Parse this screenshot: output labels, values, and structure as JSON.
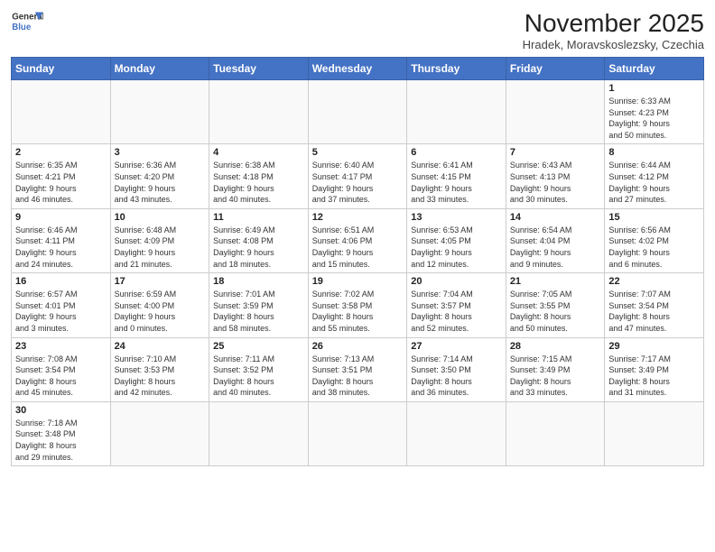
{
  "header": {
    "logo_general": "General",
    "logo_blue": "Blue",
    "title": "November 2025",
    "subtitle": "Hradek, Moravskoslezsky, Czechia"
  },
  "weekdays": [
    "Sunday",
    "Monday",
    "Tuesday",
    "Wednesday",
    "Thursday",
    "Friday",
    "Saturday"
  ],
  "weeks": [
    [
      {
        "day": "",
        "info": ""
      },
      {
        "day": "",
        "info": ""
      },
      {
        "day": "",
        "info": ""
      },
      {
        "day": "",
        "info": ""
      },
      {
        "day": "",
        "info": ""
      },
      {
        "day": "",
        "info": ""
      },
      {
        "day": "1",
        "info": "Sunrise: 6:33 AM\nSunset: 4:23 PM\nDaylight: 9 hours\nand 50 minutes."
      }
    ],
    [
      {
        "day": "2",
        "info": "Sunrise: 6:35 AM\nSunset: 4:21 PM\nDaylight: 9 hours\nand 46 minutes."
      },
      {
        "day": "3",
        "info": "Sunrise: 6:36 AM\nSunset: 4:20 PM\nDaylight: 9 hours\nand 43 minutes."
      },
      {
        "day": "4",
        "info": "Sunrise: 6:38 AM\nSunset: 4:18 PM\nDaylight: 9 hours\nand 40 minutes."
      },
      {
        "day": "5",
        "info": "Sunrise: 6:40 AM\nSunset: 4:17 PM\nDaylight: 9 hours\nand 37 minutes."
      },
      {
        "day": "6",
        "info": "Sunrise: 6:41 AM\nSunset: 4:15 PM\nDaylight: 9 hours\nand 33 minutes."
      },
      {
        "day": "7",
        "info": "Sunrise: 6:43 AM\nSunset: 4:13 PM\nDaylight: 9 hours\nand 30 minutes."
      },
      {
        "day": "8",
        "info": "Sunrise: 6:44 AM\nSunset: 4:12 PM\nDaylight: 9 hours\nand 27 minutes."
      }
    ],
    [
      {
        "day": "9",
        "info": "Sunrise: 6:46 AM\nSunset: 4:11 PM\nDaylight: 9 hours\nand 24 minutes."
      },
      {
        "day": "10",
        "info": "Sunrise: 6:48 AM\nSunset: 4:09 PM\nDaylight: 9 hours\nand 21 minutes."
      },
      {
        "day": "11",
        "info": "Sunrise: 6:49 AM\nSunset: 4:08 PM\nDaylight: 9 hours\nand 18 minutes."
      },
      {
        "day": "12",
        "info": "Sunrise: 6:51 AM\nSunset: 4:06 PM\nDaylight: 9 hours\nand 15 minutes."
      },
      {
        "day": "13",
        "info": "Sunrise: 6:53 AM\nSunset: 4:05 PM\nDaylight: 9 hours\nand 12 minutes."
      },
      {
        "day": "14",
        "info": "Sunrise: 6:54 AM\nSunset: 4:04 PM\nDaylight: 9 hours\nand 9 minutes."
      },
      {
        "day": "15",
        "info": "Sunrise: 6:56 AM\nSunset: 4:02 PM\nDaylight: 9 hours\nand 6 minutes."
      }
    ],
    [
      {
        "day": "16",
        "info": "Sunrise: 6:57 AM\nSunset: 4:01 PM\nDaylight: 9 hours\nand 3 minutes."
      },
      {
        "day": "17",
        "info": "Sunrise: 6:59 AM\nSunset: 4:00 PM\nDaylight: 9 hours\nand 0 minutes."
      },
      {
        "day": "18",
        "info": "Sunrise: 7:01 AM\nSunset: 3:59 PM\nDaylight: 8 hours\nand 58 minutes."
      },
      {
        "day": "19",
        "info": "Sunrise: 7:02 AM\nSunset: 3:58 PM\nDaylight: 8 hours\nand 55 minutes."
      },
      {
        "day": "20",
        "info": "Sunrise: 7:04 AM\nSunset: 3:57 PM\nDaylight: 8 hours\nand 52 minutes."
      },
      {
        "day": "21",
        "info": "Sunrise: 7:05 AM\nSunset: 3:55 PM\nDaylight: 8 hours\nand 50 minutes."
      },
      {
        "day": "22",
        "info": "Sunrise: 7:07 AM\nSunset: 3:54 PM\nDaylight: 8 hours\nand 47 minutes."
      }
    ],
    [
      {
        "day": "23",
        "info": "Sunrise: 7:08 AM\nSunset: 3:54 PM\nDaylight: 8 hours\nand 45 minutes."
      },
      {
        "day": "24",
        "info": "Sunrise: 7:10 AM\nSunset: 3:53 PM\nDaylight: 8 hours\nand 42 minutes."
      },
      {
        "day": "25",
        "info": "Sunrise: 7:11 AM\nSunset: 3:52 PM\nDaylight: 8 hours\nand 40 minutes."
      },
      {
        "day": "26",
        "info": "Sunrise: 7:13 AM\nSunset: 3:51 PM\nDaylight: 8 hours\nand 38 minutes."
      },
      {
        "day": "27",
        "info": "Sunrise: 7:14 AM\nSunset: 3:50 PM\nDaylight: 8 hours\nand 36 minutes."
      },
      {
        "day": "28",
        "info": "Sunrise: 7:15 AM\nSunset: 3:49 PM\nDaylight: 8 hours\nand 33 minutes."
      },
      {
        "day": "29",
        "info": "Sunrise: 7:17 AM\nSunset: 3:49 PM\nDaylight: 8 hours\nand 31 minutes."
      }
    ],
    [
      {
        "day": "30",
        "info": "Sunrise: 7:18 AM\nSunset: 3:48 PM\nDaylight: 8 hours\nand 29 minutes."
      },
      {
        "day": "",
        "info": ""
      },
      {
        "day": "",
        "info": ""
      },
      {
        "day": "",
        "info": ""
      },
      {
        "day": "",
        "info": ""
      },
      {
        "day": "",
        "info": ""
      },
      {
        "day": "",
        "info": ""
      }
    ]
  ]
}
